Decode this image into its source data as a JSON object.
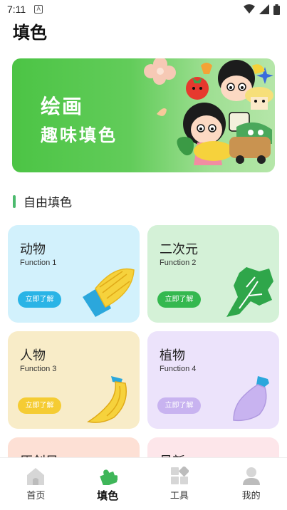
{
  "status": {
    "time": "7:11",
    "notif_glyph": "A"
  },
  "page_title": "填色",
  "banner": {
    "title": "绘画",
    "subtitle": "趣味填色"
  },
  "section": {
    "title": "自由填色"
  },
  "cards": [
    {
      "title": "动物",
      "subtitle": "Function 1",
      "button": "立即了解",
      "bg": "#d2f1fc",
      "btn": "#2ab4e6",
      "icon": "corn-icon"
    },
    {
      "title": "二次元",
      "subtitle": "Function 2",
      "button": "立即了解",
      "bg": "#d4f1d7",
      "btn": "#34b84f",
      "icon": "lettuce-icon"
    },
    {
      "title": "人物",
      "subtitle": "Function 3",
      "button": "立即了解",
      "bg": "#f8ecc8",
      "btn": "#f5cc33",
      "icon": "banana-icon"
    },
    {
      "title": "植物",
      "subtitle": "Function 4",
      "button": "立即了解",
      "bg": "#ece3fb",
      "btn": "#c8b3f0",
      "icon": "eggplant-icon"
    },
    {
      "title": "原创风",
      "subtitle": "",
      "button": "",
      "bg": "#fde0d5",
      "btn": "#f0a080",
      "icon": ""
    },
    {
      "title": "最新",
      "subtitle": "",
      "button": "",
      "bg": "#fde6ea",
      "btn": "#f0a0b0",
      "icon": ""
    }
  ],
  "tabs": [
    {
      "label": "首页",
      "icon": "home-icon",
      "active": false
    },
    {
      "label": "填色",
      "icon": "puzzle-icon",
      "active": true
    },
    {
      "label": "工具",
      "icon": "grid-icon",
      "active": false
    },
    {
      "label": "我的",
      "icon": "user-icon",
      "active": false
    }
  ]
}
